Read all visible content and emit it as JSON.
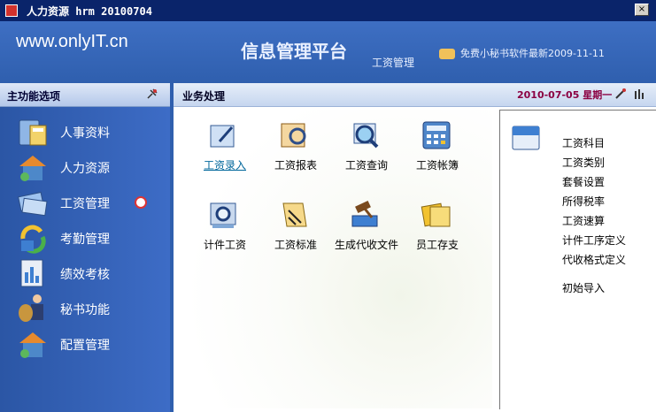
{
  "window": {
    "title": "人力资源 hrm 20100704",
    "close": "×"
  },
  "header": {
    "logo": "www.onlyIT.cn",
    "platform": "信息管理平台",
    "module": "工资管理",
    "news": "免费小秘书软件最新2009-11-11"
  },
  "sidebar": {
    "title": "主功能选项",
    "items": [
      {
        "label": "人事资料",
        "icon": "calculator-icon"
      },
      {
        "label": "人力资源",
        "icon": "house-icon"
      },
      {
        "label": "工资管理",
        "icon": "money-icon"
      },
      {
        "label": "考勤管理",
        "icon": "refresh-icon"
      },
      {
        "label": "绩效考核",
        "icon": "chart-icon"
      },
      {
        "label": "秘书功能",
        "icon": "secretary-icon"
      },
      {
        "label": "配置管理",
        "icon": "house-icon"
      }
    ]
  },
  "content": {
    "title": "业务处理",
    "date": "2010-07-05  星期一",
    "tiles": [
      {
        "label": "工资录入",
        "icon": "salary-entry-icon"
      },
      {
        "label": "工资报表",
        "icon": "report-icon"
      },
      {
        "label": "工资查询",
        "icon": "search-icon"
      },
      {
        "label": "工资帐簿",
        "icon": "calculator-icon"
      },
      {
        "label": "计件工资",
        "icon": "piece-icon"
      },
      {
        "label": "工资标准",
        "icon": "standard-icon"
      },
      {
        "label": "生成代收文件",
        "icon": "gavel-icon"
      },
      {
        "label": "员工存支",
        "icon": "notes-icon"
      }
    ]
  },
  "panel": {
    "items": [
      "工资科目",
      "工资类别",
      "套餐设置",
      "所得税率",
      "工资速算",
      "计件工序定义",
      "代收格式定义"
    ],
    "extra": "初始导入"
  }
}
